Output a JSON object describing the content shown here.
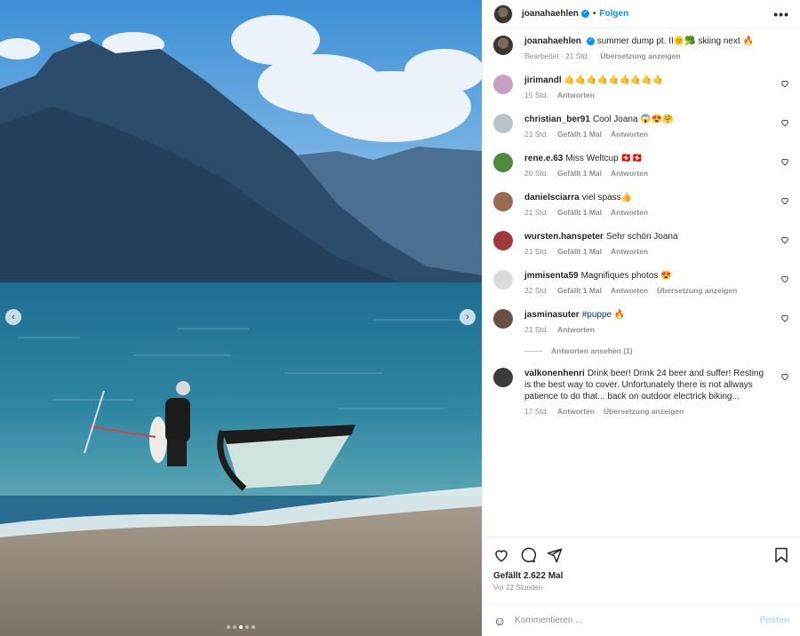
{
  "author": {
    "username": "joanahaehlen",
    "follow_label": "Folgen",
    "separator": "•"
  },
  "caption": {
    "username": "joanahaehlen",
    "text": "summer dump pt. II🌞🥦 skiing next 🔥",
    "edited_label": "Bearbeitet",
    "time": "21 Std.",
    "translation_label": "Übersetzung anzeigen"
  },
  "comments": [
    {
      "username": "jirimandl",
      "text": "🤙🤙🤙🤙🤙🤙🤙🤙🤙",
      "time": "15 Std.",
      "likes": "",
      "reply": "Antworten",
      "translation": "",
      "avatar_color": "#c9a0c0"
    },
    {
      "username": "christian_ber91",
      "text": "Cool Joana 😱😍🤗",
      "time": "21 Std.",
      "likes": "Gefällt 1 Mal",
      "reply": "Antworten",
      "translation": "",
      "avatar_color": "#b9c2c6"
    },
    {
      "username": "rene.e.63",
      "text": "Miss Weltcup 🇨🇭🇨🇭",
      "time": "20 Std.",
      "likes": "Gefällt 1 Mal",
      "reply": "Antworten",
      "translation": "",
      "avatar_color": "#4f8a3c"
    },
    {
      "username": "danielsciarra",
      "text": "viel spass👍",
      "time": "21 Std.",
      "likes": "Gefällt 1 Mal",
      "reply": "Antworten",
      "translation": "",
      "avatar_color": "#9a6a50"
    },
    {
      "username": "wursten.hanspeter",
      "text": "Sehr schön Joana",
      "time": "21 Std.",
      "likes": "Gefällt 1 Mal",
      "reply": "Antworten",
      "translation": "",
      "avatar_color": "#a03a3a"
    },
    {
      "username": "jmmisenta59",
      "text": "Magnifiques photos 😍",
      "time": "22 Std.",
      "likes": "Gefällt 1 Mal",
      "reply": "Antworten",
      "translation": "Übersetzung anzeigen",
      "avatar_color": "#dbdbdb"
    },
    {
      "username": "jasminasuter",
      "text": "🔥",
      "hashtag": "#puppe",
      "time": "21 Std.",
      "likes": "",
      "reply": "Antworten",
      "translation": "",
      "avatar_color": "#6a5040"
    },
    {
      "username": "valkonenhenri",
      "text": "Drink beer! Drink 24 beer and suffer! Resting is the best way to cover. Unfortunately there is not allways patience to do that... back on outdoor electrick biking...",
      "time": "17 Std.",
      "likes": "",
      "reply": "Antworten",
      "translation": "Übersetzung anzeigen",
      "avatar_color": "#3b3b3b"
    }
  ],
  "view_replies_label": "Antworten ansehen (1)",
  "engagement": {
    "likes_label": "Gefällt 2.622 Mal",
    "posted_time": "Vor 22 Stunden"
  },
  "comment_box": {
    "placeholder": "Kommentieren ...",
    "post_label": "Posten"
  },
  "icons": {
    "like": "heart-icon",
    "comment": "comment-icon",
    "share": "paper-plane-icon",
    "save": "bookmark-icon",
    "options": "more-icon",
    "emoji": "emoji-icon"
  },
  "colors": {
    "accent": "#0095f6",
    "hashtag": "#00376b",
    "muted": "#8e8e8e"
  }
}
